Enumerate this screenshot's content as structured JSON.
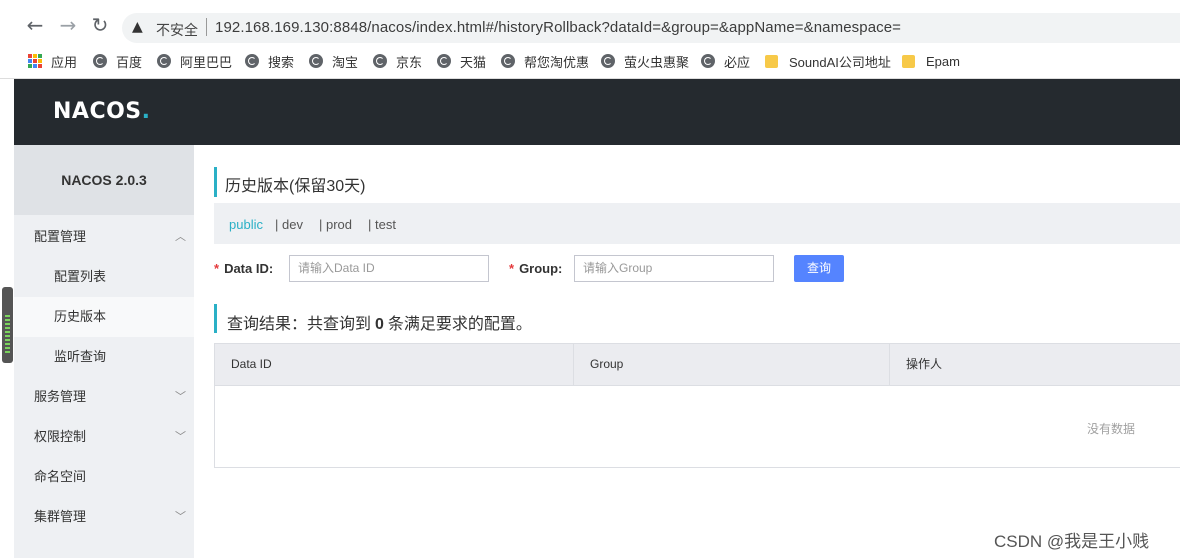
{
  "browser": {
    "insecure_label": "不安全",
    "url": "192.168.169.130:8848/nacos/index.html#/historyRollback?dataId=&group=&appName=&namespace=",
    "bookmarks": [
      "应用",
      "百度",
      "阿里巴巴",
      "搜索",
      "淘宝",
      "京东",
      "天猫",
      "帮您淘优惠",
      "萤火虫惠聚",
      "必应",
      "SoundAI公司地址",
      "Epam"
    ]
  },
  "header": {
    "logo_part1": "NA",
    "logo_part2": "C",
    "logo_part3": "OS",
    "logo_dot": "."
  },
  "sidebar": {
    "version": "NACOS 2.0.3",
    "items": [
      {
        "label": "配置管理"
      },
      {
        "label": "配置列表"
      },
      {
        "label": "历史版本"
      },
      {
        "label": "监听查询"
      },
      {
        "label": "服务管理"
      },
      {
        "label": "权限控制"
      },
      {
        "label": "命名空间"
      },
      {
        "label": "集群管理"
      }
    ]
  },
  "main": {
    "title": "历史版本(保留30天)",
    "namespaces": [
      "public",
      "| dev",
      "| prod",
      "| test"
    ],
    "filters": {
      "dataid_label": "Data ID:",
      "dataid_placeholder": "请输入Data ID",
      "group_label": "Group:",
      "group_placeholder": "请输入Group",
      "query_button": "查询"
    },
    "result": {
      "prefix": "查询结果：共查询到",
      "count": "0",
      "suffix": "条满足要求的配置。"
    },
    "table": {
      "columns": [
        "Data ID",
        "Group",
        "操作人"
      ],
      "empty_text": "没有数据"
    }
  },
  "watermark": "CSDN @我是王小贱",
  "colors": {
    "accent": "#2ab0c6",
    "primary_button": "#5584ff",
    "header_bg": "#252a2f",
    "required": "#e4393c"
  }
}
